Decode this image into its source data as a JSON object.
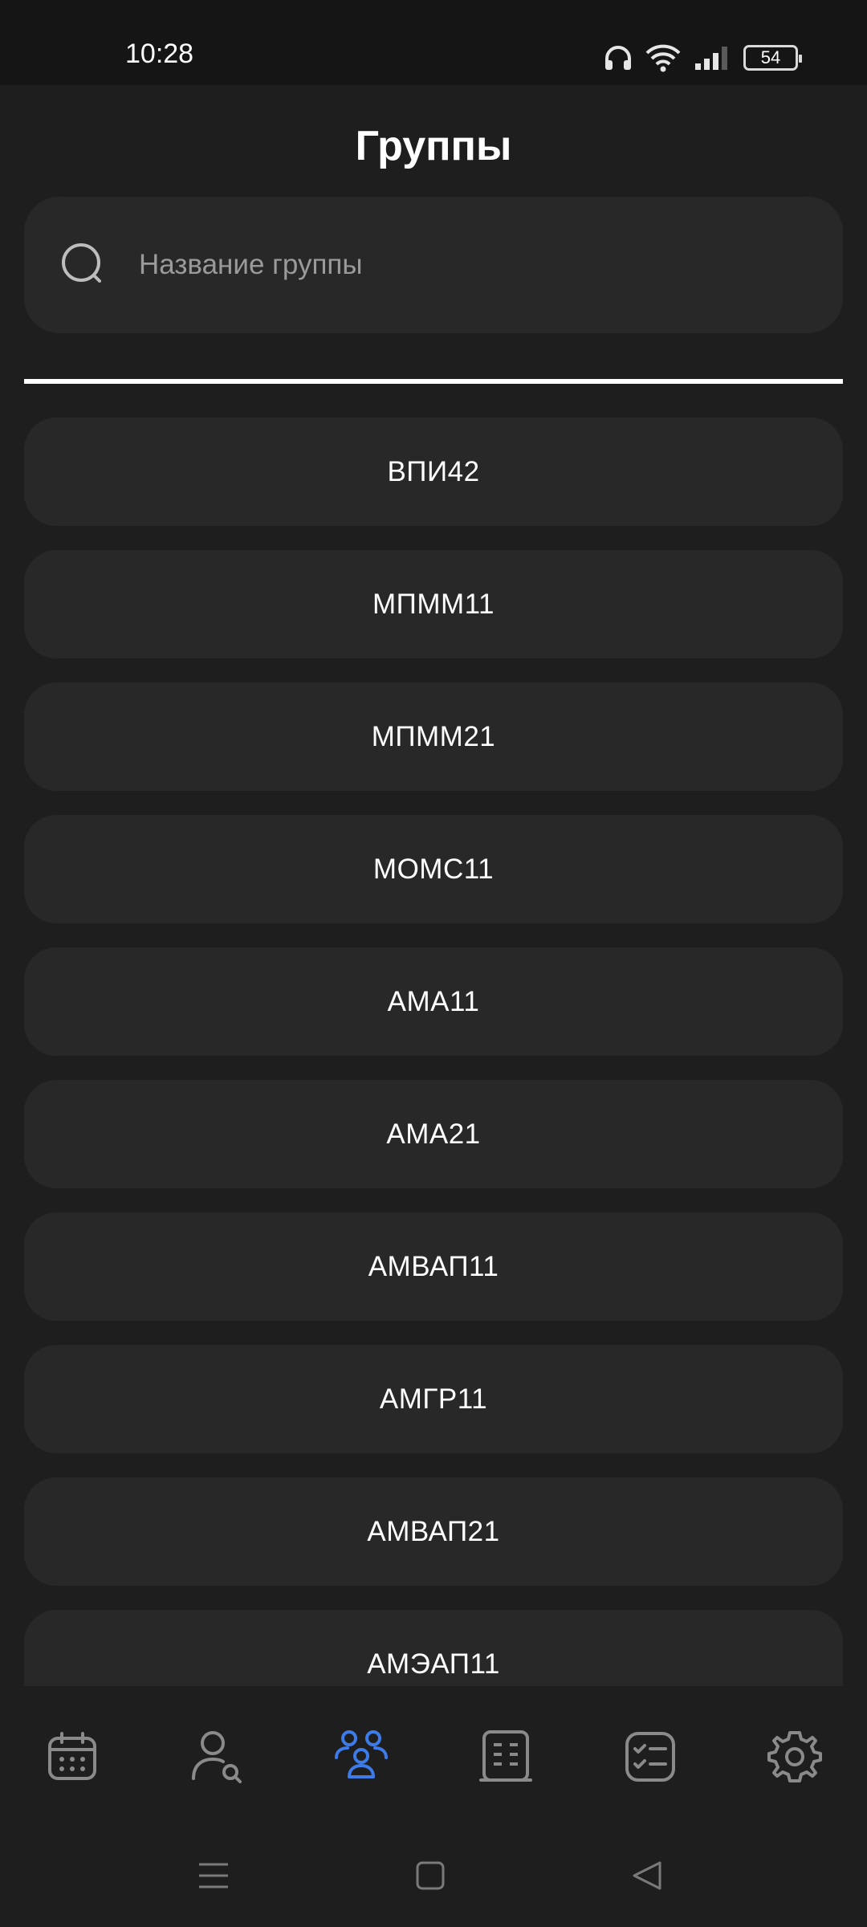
{
  "status_bar": {
    "time": "10:28",
    "battery": "54",
    "icons": [
      "headphones-icon",
      "wifi-icon",
      "signal-icon",
      "battery-icon"
    ]
  },
  "header": {
    "title": "Группы"
  },
  "search": {
    "placeholder": "Название группы",
    "value": ""
  },
  "groups": [
    "ВПИ42",
    "МПММ11",
    "МПММ21",
    "МОМС11",
    "АМА11",
    "АМА21",
    "АМВАП11",
    "АМГР11",
    "АМВАП21",
    "АМЭАП11"
  ],
  "bottom_nav": {
    "items": [
      "calendar-icon",
      "user-search-icon",
      "groups-icon",
      "building-icon",
      "checklist-icon",
      "gear-icon"
    ],
    "active_index": 2
  },
  "colors": {
    "background": "#1e1e1e",
    "card": "#282828",
    "accent": "#3d7be8",
    "icon_inactive": "#8a8a8a"
  }
}
